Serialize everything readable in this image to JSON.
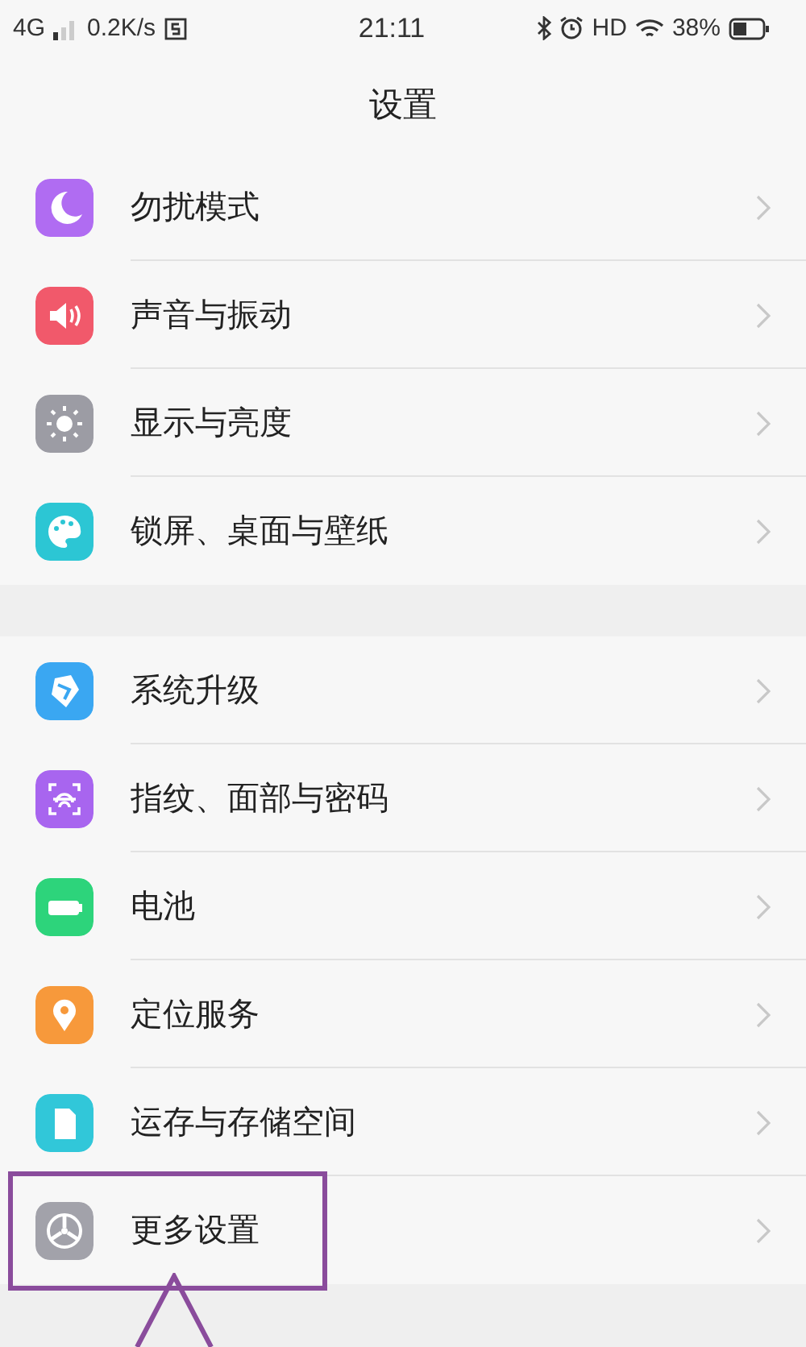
{
  "status_bar": {
    "network": "4G",
    "speed": "0.2K/s",
    "time": "21:11",
    "hd": "HD",
    "battery": "38%"
  },
  "title": "设置",
  "groups": [
    {
      "items": [
        {
          "label": "勿扰模式",
          "highlighted": false
        },
        {
          "label": "声音与振动",
          "highlighted": false
        },
        {
          "label": "显示与亮度",
          "highlighted": false
        },
        {
          "label": "锁屏、桌面与壁纸",
          "highlighted": false
        }
      ]
    },
    {
      "items": [
        {
          "label": "系统升级",
          "highlighted": false
        },
        {
          "label": "指纹、面部与密码",
          "highlighted": false
        },
        {
          "label": "电池",
          "highlighted": false
        },
        {
          "label": "定位服务",
          "highlighted": false
        },
        {
          "label": "运存与存储空间",
          "highlighted": false
        },
        {
          "label": "更多设置",
          "highlighted": true
        }
      ]
    }
  ]
}
